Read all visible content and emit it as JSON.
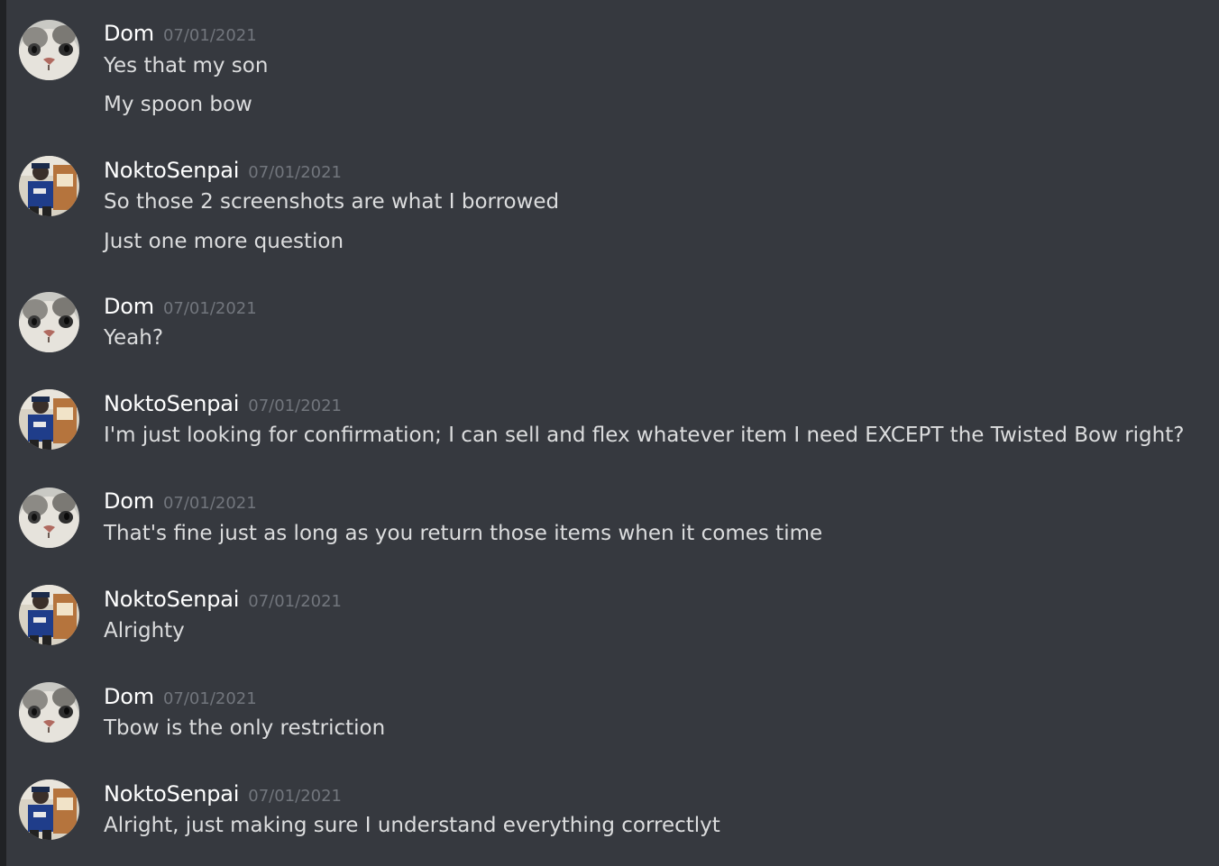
{
  "users": {
    "dom": {
      "name": "Dom",
      "avatar_icon": "cat-face-icon"
    },
    "nokto": {
      "name": "NoktoSenpai",
      "avatar_icon": "person-figure-icon"
    }
  },
  "messages": [
    {
      "author": "Dom",
      "timestamp": "07/01/2021",
      "lines": [
        "Yes that my son",
        "My spoon bow"
      ]
    },
    {
      "author": "NoktoSenpai",
      "timestamp": "07/01/2021",
      "lines": [
        "So those 2 screenshots are what I borrowed",
        "Just one more question"
      ]
    },
    {
      "author": "Dom",
      "timestamp": "07/01/2021",
      "lines": [
        "Yeah?"
      ]
    },
    {
      "author": "NoktoSenpai",
      "timestamp": "07/01/2021",
      "lines": [
        "I'm just looking for confirmation; I can sell and flex whatever item I need EXCEPT the Twisted Bow right?"
      ]
    },
    {
      "author": "Dom",
      "timestamp": "07/01/2021",
      "lines": [
        "That's fine just as long as you return those items when it comes time"
      ]
    },
    {
      "author": "NoktoSenpai",
      "timestamp": "07/01/2021",
      "lines": [
        "Alrighty"
      ]
    },
    {
      "author": "Dom",
      "timestamp": "07/01/2021",
      "lines": [
        "Tbow is the only restriction"
      ]
    },
    {
      "author": "NoktoSenpai",
      "timestamp": "07/01/2021",
      "lines": [
        "Alright, just making sure I understand everything correctlyt"
      ]
    }
  ],
  "colors": {
    "background": "#36393f",
    "username": "#ffffff",
    "timestamp": "#72767d",
    "message_text": "#dcddde"
  }
}
